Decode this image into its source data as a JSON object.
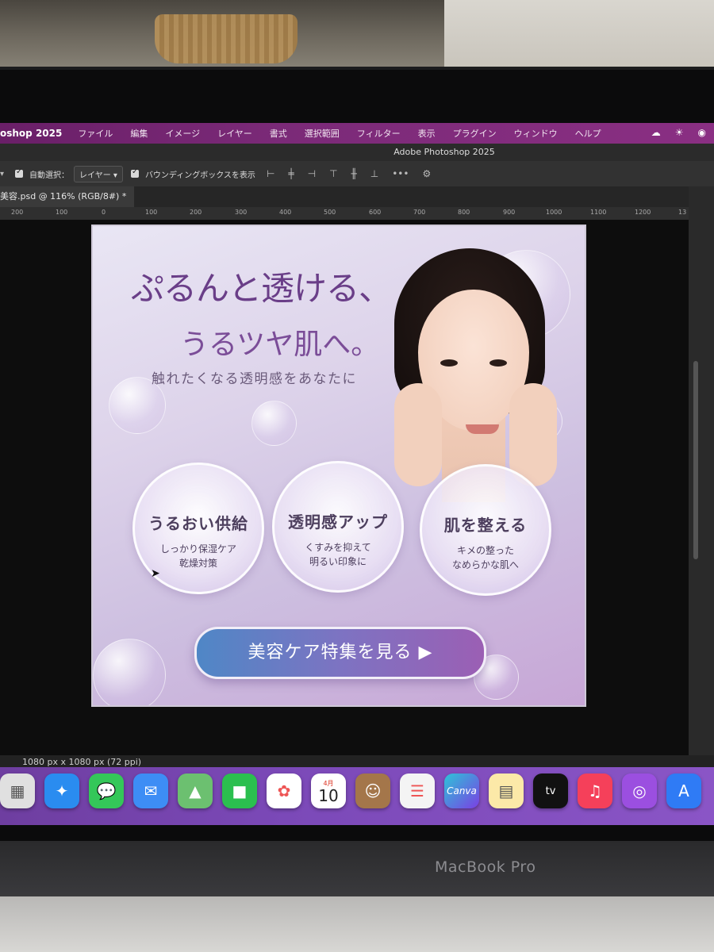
{
  "menubar": {
    "app": "oshop 2025",
    "items": [
      "ファイル",
      "編集",
      "イメージ",
      "レイヤー",
      "書式",
      "選択範囲",
      "フィルター",
      "表示",
      "プラグイン",
      "ウィンドウ",
      "ヘルプ"
    ]
  },
  "window": {
    "title": "Adobe Photoshop 2025"
  },
  "options": {
    "auto_select_label": "自動選択：",
    "auto_select_value": "レイヤー",
    "bounding_box_label": "バウンディングボックスを表示",
    "more": "•••"
  },
  "document": {
    "tab": "美容.psd @ 116% (RGB/8#) *"
  },
  "ruler": {
    "ticks": [
      "200",
      "100",
      "0",
      "100",
      "200",
      "300",
      "400",
      "500",
      "600",
      "700",
      "800",
      "900",
      "1000",
      "1100",
      "1200",
      "13"
    ]
  },
  "artwork": {
    "headline_line1": "ぷるんと透ける、",
    "headline_line2": "うるツヤ肌へ。",
    "tagline": "触れたくなる透明感をあなたに",
    "features": [
      {
        "title": "うるおい供給",
        "line1": "しっかり保湿ケア",
        "line2": "乾燥対策"
      },
      {
        "title": "透明感アップ",
        "line1": "くすみを抑えて",
        "line2": "明るい印象に"
      },
      {
        "title": "肌を整える",
        "line1": "キメの整った",
        "line2": "なめらかな肌へ"
      }
    ],
    "cta": "美容ケア特集を見る ▶"
  },
  "status": {
    "size": "1080 px x 1080 px (72 ppi)"
  },
  "dock": {
    "calendar_month": "4月",
    "calendar_day": "10",
    "canva": "Canva",
    "tv": "tv"
  },
  "device": {
    "brand": "MacBook Pro"
  }
}
